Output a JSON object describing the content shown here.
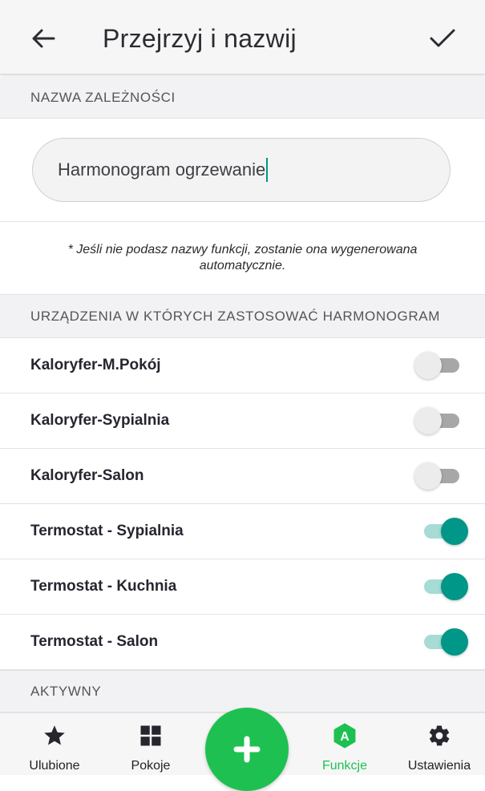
{
  "header": {
    "title": "Przejrzyj i nazwij"
  },
  "name_section": {
    "header": "NAZWA ZALEŻNOŚCI",
    "input_value": "Harmonogram ogrzewanie"
  },
  "hint": "* Jeśli nie podasz nazwy funkcji, zostanie ona wygenerowana automatycznie.",
  "devices_section": {
    "header": "URZĄDZENIA W KTÓRYCH ZASTOSOWAĆ HARMONOGRAM",
    "devices": [
      {
        "label": "Kaloryfer-M.Pokój",
        "enabled": false
      },
      {
        "label": "Kaloryfer-Sypialnia",
        "enabled": false
      },
      {
        "label": "Kaloryfer-Salon",
        "enabled": false
      },
      {
        "label": "Termostat - Sypialnia",
        "enabled": true
      },
      {
        "label": "Termostat - Kuchnia",
        "enabled": true
      },
      {
        "label": "Termostat - Salon",
        "enabled": true
      }
    ]
  },
  "active_section": {
    "header": "AKTYWNY"
  },
  "bottom_nav": {
    "items": [
      {
        "label": "Ulubione",
        "icon": "star-icon",
        "active": false
      },
      {
        "label": "Pokoje",
        "icon": "grid-icon",
        "active": false
      },
      {
        "label": "Funkcje",
        "icon": "functions-hexagon-icon",
        "active": true
      },
      {
        "label": "Ustawienia",
        "icon": "gear-icon",
        "active": false
      }
    ],
    "fab_icon": "plus-icon",
    "functions_icon_letter": "A"
  },
  "colors": {
    "accent": "#009688",
    "accent_light": "#a6dbd6",
    "fab": "#1ec151",
    "active_nav": "#1ec151"
  }
}
